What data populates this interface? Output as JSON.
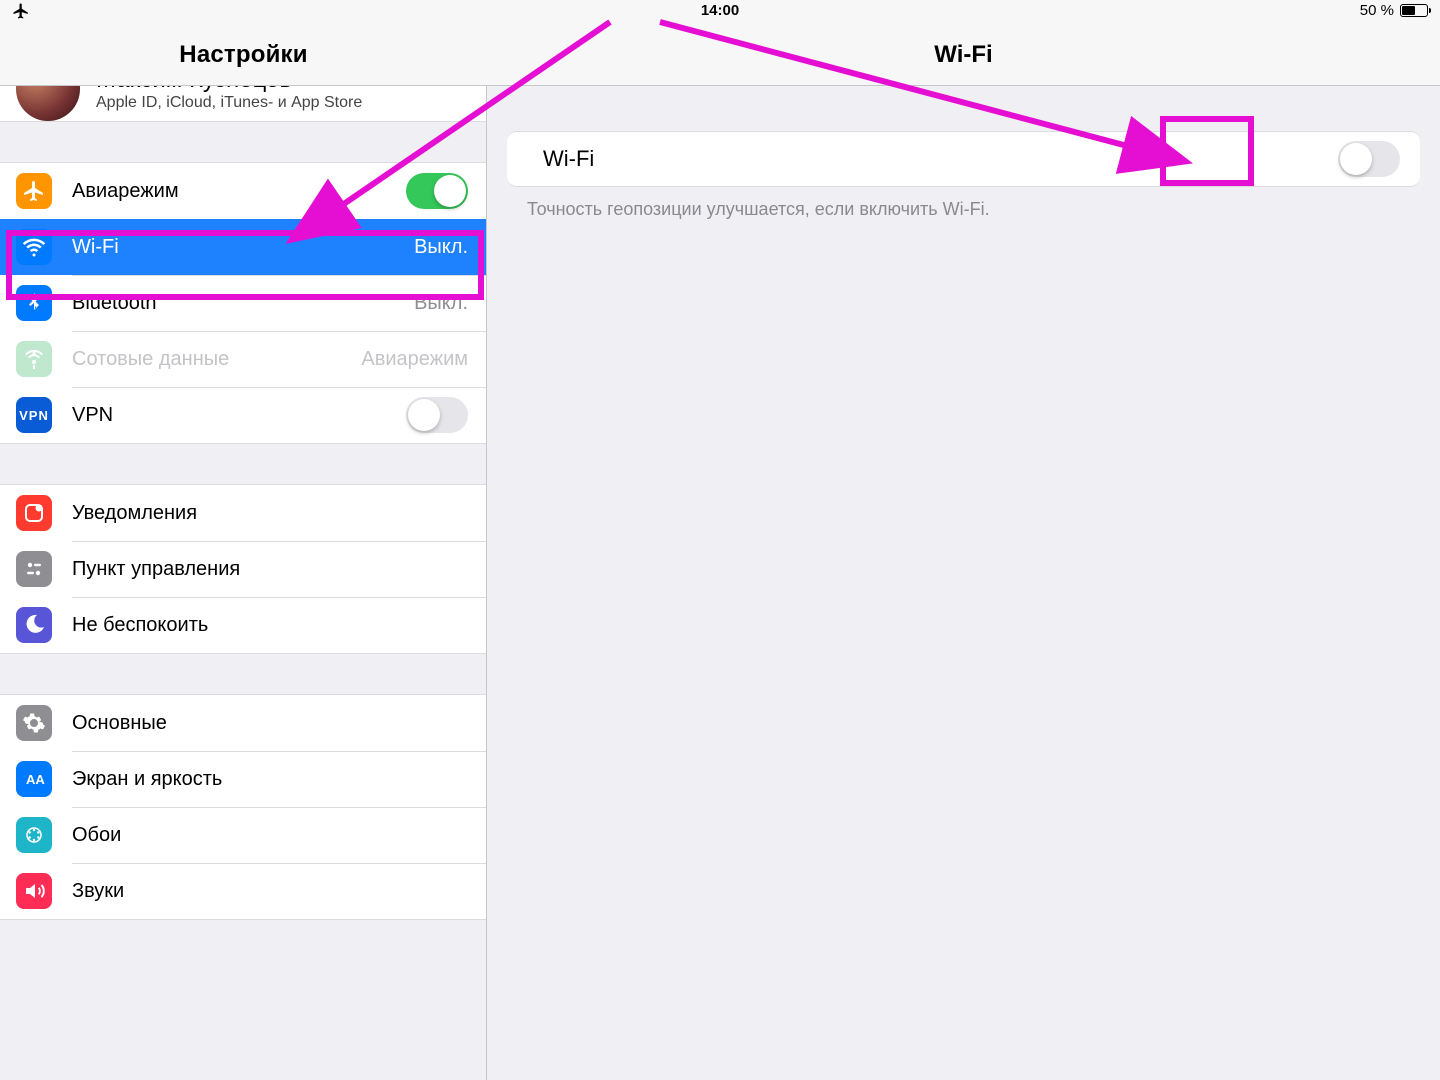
{
  "statusbar": {
    "time": "14:00",
    "battery_text": "50 %"
  },
  "sidebar": {
    "title": "Настройки",
    "profile": {
      "name": "Максим Кузнецов",
      "sub": "Apple ID, iCloud, iTunes- и App Store"
    },
    "group1": {
      "airplane": {
        "label": "Авиарежим"
      },
      "wifi": {
        "label": "Wi-Fi",
        "value": "Выкл."
      },
      "bluetooth": {
        "label": "Bluetooth",
        "value": "Выкл."
      },
      "cellular": {
        "label": "Сотовые данные",
        "value": "Авиарежим"
      },
      "vpn": {
        "label": "VPN"
      }
    },
    "group2": {
      "notifications": {
        "label": "Уведомления"
      },
      "controlcenter": {
        "label": "Пункт управления"
      },
      "dnd": {
        "label": "Не беспокоить"
      }
    },
    "group3": {
      "general": {
        "label": "Основные"
      },
      "display": {
        "label": "Экран и яркость"
      },
      "wallpaper": {
        "label": "Обои"
      },
      "sounds": {
        "label": "Звуки"
      }
    }
  },
  "detail": {
    "title": "Wi-Fi",
    "wifi_label": "Wi-Fi",
    "hint": "Точность геопозиции улучшается, если включить Wi-Fi."
  }
}
